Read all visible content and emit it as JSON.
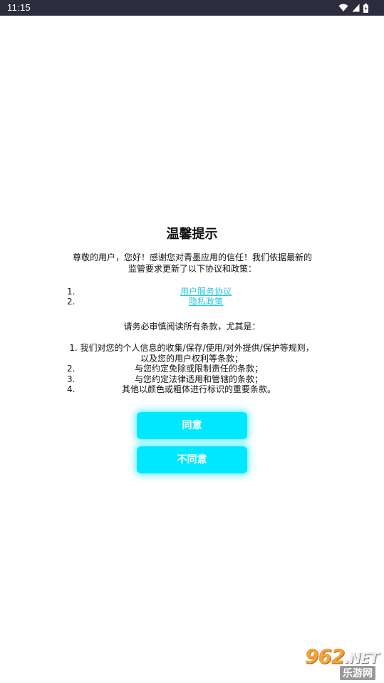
{
  "status_bar": {
    "time": "11:15"
  },
  "dialog": {
    "title": "温馨提示",
    "intro": "尊敬的用户，您好！感谢您对青墨应用的信任！我们依据最新的监管要求更新了以下协议和政策：",
    "policies": [
      {
        "num": "1.",
        "label": "用户服务协议"
      },
      {
        "num": "2.",
        "label": "隐私政策"
      }
    ],
    "notice_lead": "请务必审慎阅读所有条款，尤其是：",
    "terms": [
      {
        "num": "1.",
        "text": "我们对您的个人信息的收集/保存/使用/对外提供/保护等规则，以及您的用户权利等条款；"
      },
      {
        "num": "2.",
        "text": "与您约定免除或限制责任的条款；"
      },
      {
        "num": "3.",
        "text": "与您约定法律适用和管辖的条款；"
      },
      {
        "num": "4.",
        "text": "其他以颜色或粗体进行标识的重要条款。"
      }
    ],
    "agree_label": "同意",
    "disagree_label": "不同意"
  },
  "watermark": {
    "logo": "962",
    "logo_suffix": ".NET",
    "subtitle": "乐游网"
  },
  "colors": {
    "accent": "#00e8ff",
    "link": "#29c6dc",
    "status_bar": "#2c2c3d"
  }
}
